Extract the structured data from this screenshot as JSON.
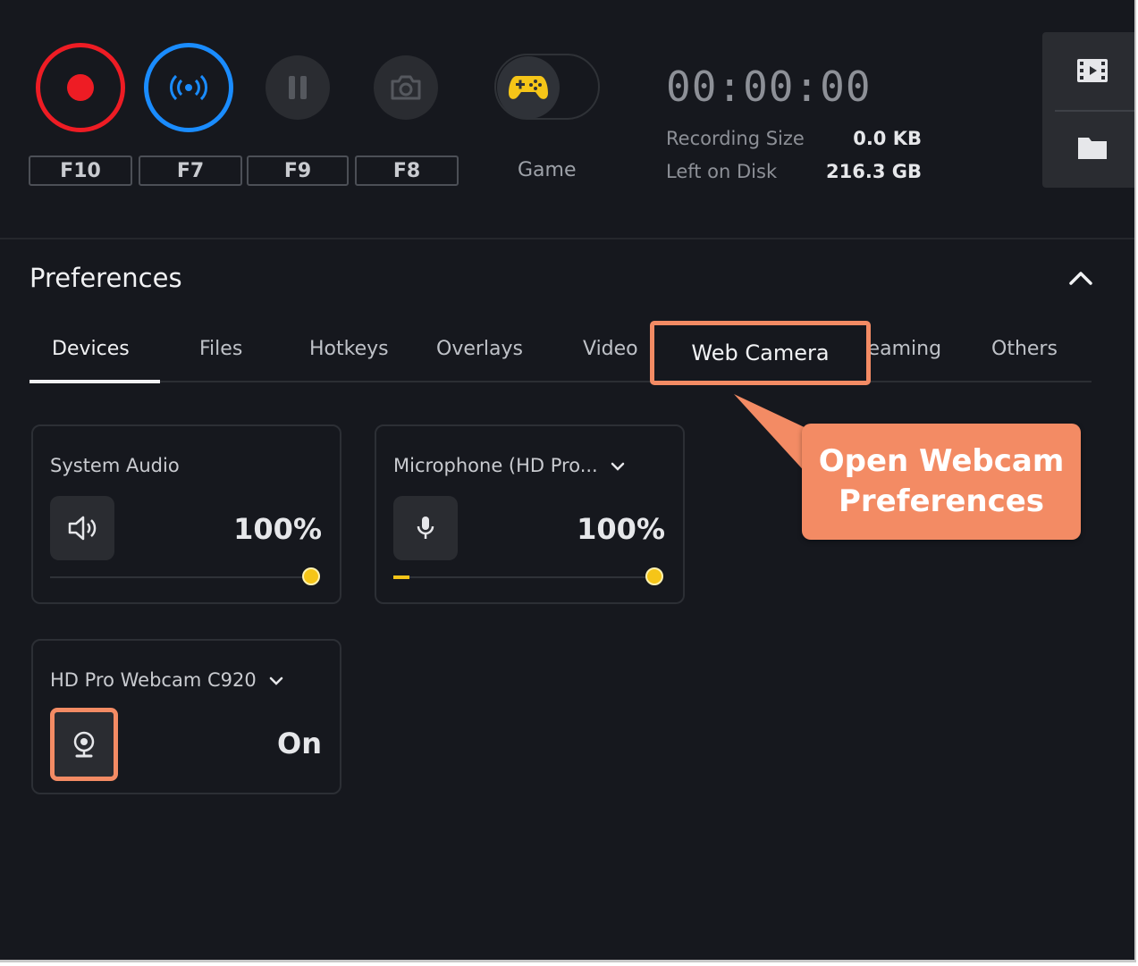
{
  "toolbar": {
    "hotkeys": {
      "record": "F10",
      "stream": "F7",
      "pause": "F9",
      "screenshot": "F8"
    },
    "game_label": "Game",
    "timer": "00:00:00",
    "recording_size_label": "Recording Size",
    "recording_size_value": "0.0 KB",
    "left_on_disk_label": "Left on Disk",
    "left_on_disk_value": "216.3 GB"
  },
  "preferences": {
    "title": "Preferences",
    "tabs": [
      {
        "label": "Devices",
        "active": true
      },
      {
        "label": "Files"
      },
      {
        "label": "Hotkeys"
      },
      {
        "label": "Overlays"
      },
      {
        "label": "Video"
      },
      {
        "label": "Web Camera",
        "highlighted": true
      },
      {
        "label": "reaming"
      },
      {
        "label": "Others"
      }
    ]
  },
  "callout": {
    "line1": "Open Webcam",
    "line2": "Preferences"
  },
  "devices": {
    "system_audio": {
      "title": "System Audio",
      "value": "100%",
      "level": 1.0
    },
    "microphone": {
      "title": "Microphone (HD Pro...",
      "value": "100%",
      "level": 1.0,
      "input_level": 0.06
    },
    "webcam": {
      "title": "HD Pro Webcam C920",
      "value": "On"
    }
  },
  "colors": {
    "background": "#16181e",
    "record": "#ee1c24",
    "stream": "#1a8cff",
    "highlight": "#f38b64",
    "slider": "#f5c518"
  },
  "icons": [
    "record-icon",
    "stream-icon",
    "pause-icon",
    "camera-icon",
    "gamepad-icon",
    "film-icon",
    "folder-icon",
    "chevron-up-icon",
    "speaker-icon",
    "microphone-icon",
    "webcam-icon",
    "chevron-down-icon"
  ]
}
